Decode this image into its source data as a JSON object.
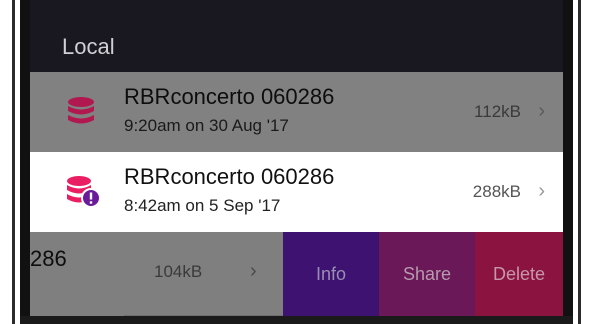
{
  "section": {
    "title": "Local"
  },
  "files": [
    {
      "title": "RBRconcerto 060286",
      "date": "9:20am on 30 Aug '17",
      "size": "112kB",
      "icon": "database-icon",
      "icon_color": "#c2185b"
    },
    {
      "title": "RBRconcerto 060286",
      "date": "8:42am on 5 Sep '17",
      "size": "288kB",
      "icon": "database-warning-icon",
      "icon_color": "#e91e63",
      "badge_color": "#6a1b9a"
    }
  ],
  "swiped_row": {
    "title_fragment": "286",
    "size": "104kB"
  },
  "actions": {
    "info": "Info",
    "share": "Share",
    "delete": "Delete"
  },
  "colors": {
    "header_bg": "#191720",
    "info_bg": "#3d1270",
    "share_bg": "#6b1858",
    "delete_bg": "#8b1340"
  }
}
